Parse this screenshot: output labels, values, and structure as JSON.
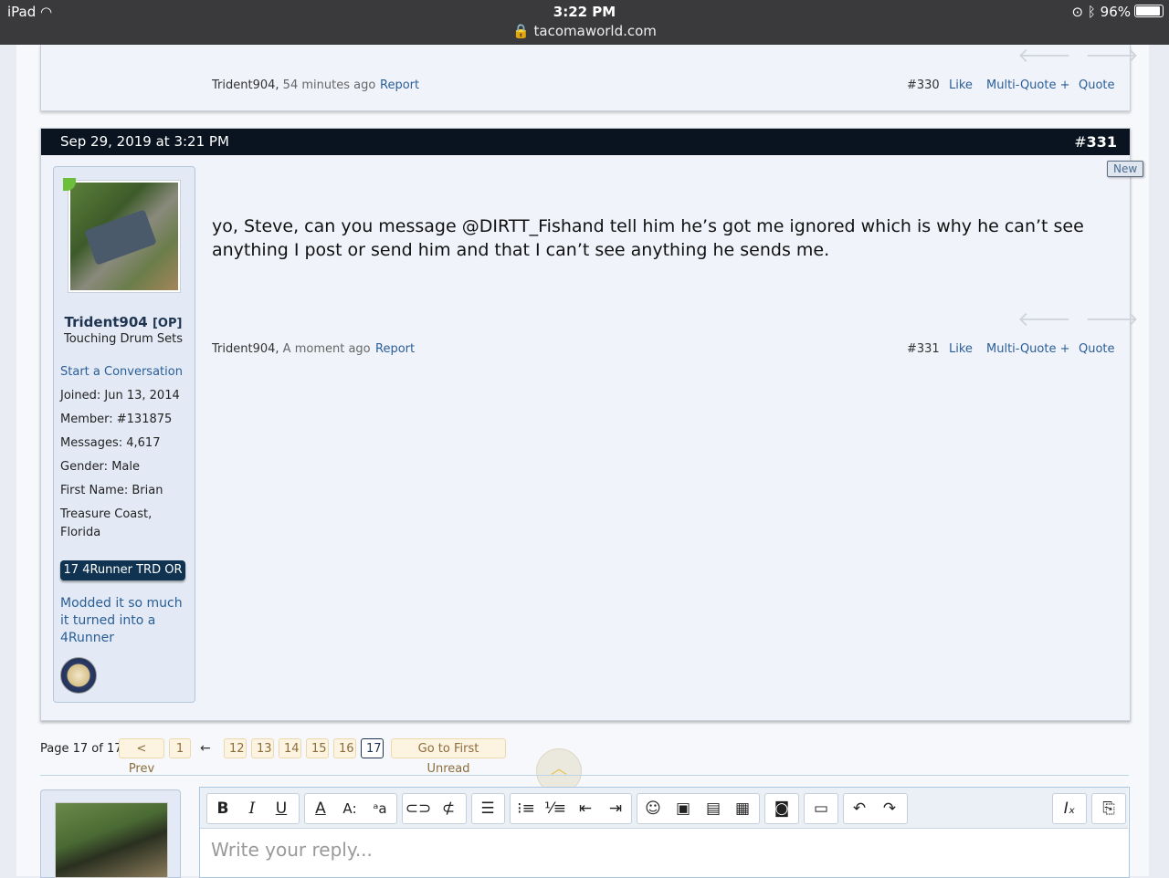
{
  "status_bar": {
    "device": "iPad",
    "time": "3:22 PM",
    "url": "tacomaworld.com",
    "battery": "96%"
  },
  "prev_post": {
    "author": "Trident904,",
    "when": "54 minutes ago",
    "report": "Report",
    "number": "#330",
    "like": "Like",
    "multiquote": "Multi-Quote +",
    "quote": "Quote"
  },
  "post": {
    "date": "Sep 29, 2019 at 3:21 PM",
    "number_hash": "#",
    "number": "331",
    "new_badge": "New",
    "message": "yo, Steve, can you message @DIRTT_Fishand tell him he’s got me ignored which is why he can’t see anything I post or send him and that I can’t see anything he sends me.",
    "author": "Trident904,",
    "when": "A moment ago",
    "report": "Report",
    "post_number": "#331",
    "like": "Like",
    "multiquote": "Multi-Quote +",
    "quote": "Quote"
  },
  "user": {
    "name": "Trident904",
    "op": "[OP]",
    "title": "Touching Drum Sets",
    "start_conversation": "Start a Conversation",
    "joined": "Joined:  Jun 13, 2014",
    "member": "Member:  #131875",
    "messages": "Messages:  4,617",
    "gender": "Gender:  Male",
    "first_name": "First Name: Brian",
    "location_1": "Treasure Coast,",
    "location_2": "Florida",
    "vehicle": "17 4Runner TRD OR",
    "modded": "Modded it so much it turned into a 4Runner"
  },
  "pagination": {
    "label": "Page 17 of 17",
    "prev": "< Prev",
    "first": "1",
    "ellipsis": "←",
    "pages": [
      "12",
      "13",
      "14",
      "15",
      "16",
      "17"
    ],
    "first_unread": "Go to First Unread"
  },
  "editor": {
    "placeholder": "Write your reply..."
  },
  "icons": {
    "arrow_left": "left-arrow-icon",
    "arrow_right": "right-arrow-icon",
    "scroll_top": "chevron-up-icon"
  }
}
